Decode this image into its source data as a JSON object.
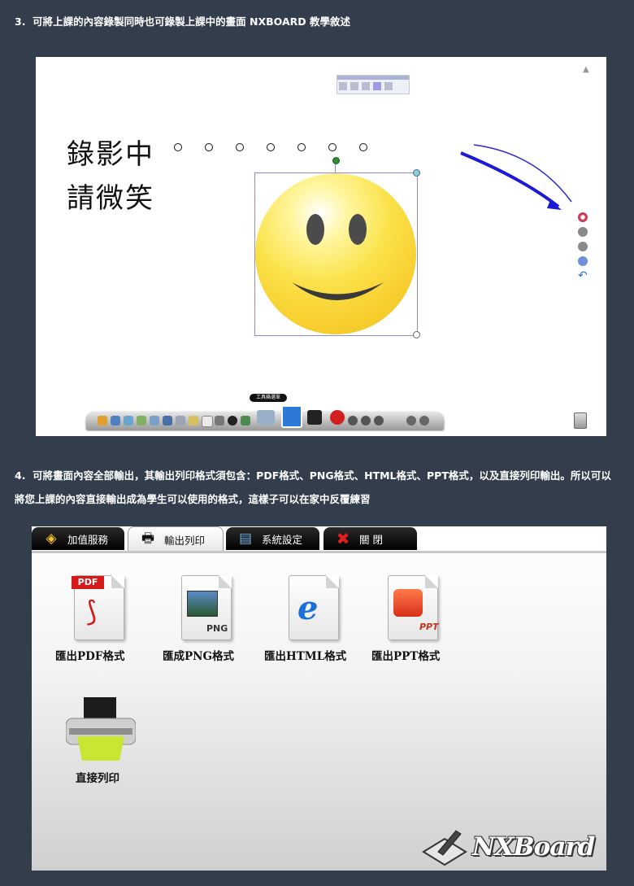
{
  "section3": {
    "number": "3.",
    "text": "可將上課的內容錄製同時也可錄製上課中的畫面 NXBOARD 教學敘述"
  },
  "canvas": {
    "recording_line1": "錄影中",
    "recording_line2": "請微笑",
    "tool_tag": "工具箱選單",
    "colors": {
      "selection": "#8c8cd8",
      "arrow": "#1b1bd6",
      "smiley": "#fbe24a"
    }
  },
  "section4": {
    "number": "4.",
    "text": "可將畫面內容全部輸出，其輸出列印格式須包含：PDF格式、PNG格式、HTML格式、PPT格式，以及直接列印輸出。所以可以將您上課的內容直接輸出成為學生可以使用的格式，這樣子可以在家中反覆練習"
  },
  "export_panel": {
    "tabs": [
      {
        "label": "加值服務",
        "icon": "layers-icon"
      },
      {
        "label": "輸出列印",
        "icon": "printer-icon"
      },
      {
        "label": "系統設定",
        "icon": "settings-icon"
      },
      {
        "label": "關 閉",
        "icon": "close-icon"
      }
    ],
    "active_tab": "輸出列印",
    "items": [
      {
        "label": "匯出PDF格式",
        "badge": "PDF",
        "icon": "pdf-file-icon"
      },
      {
        "label": "匯成PNG格式",
        "badge": "PNG",
        "icon": "png-file-icon"
      },
      {
        "label": "匯出HTML格式",
        "badge": "",
        "icon": "html-file-icon"
      },
      {
        "label": "匯出PPT格式",
        "badge": "PPT",
        "icon": "ppt-file-icon"
      },
      {
        "label": "直接列印",
        "badge": "",
        "icon": "printer-icon"
      }
    ],
    "logo": "NXBoard"
  }
}
